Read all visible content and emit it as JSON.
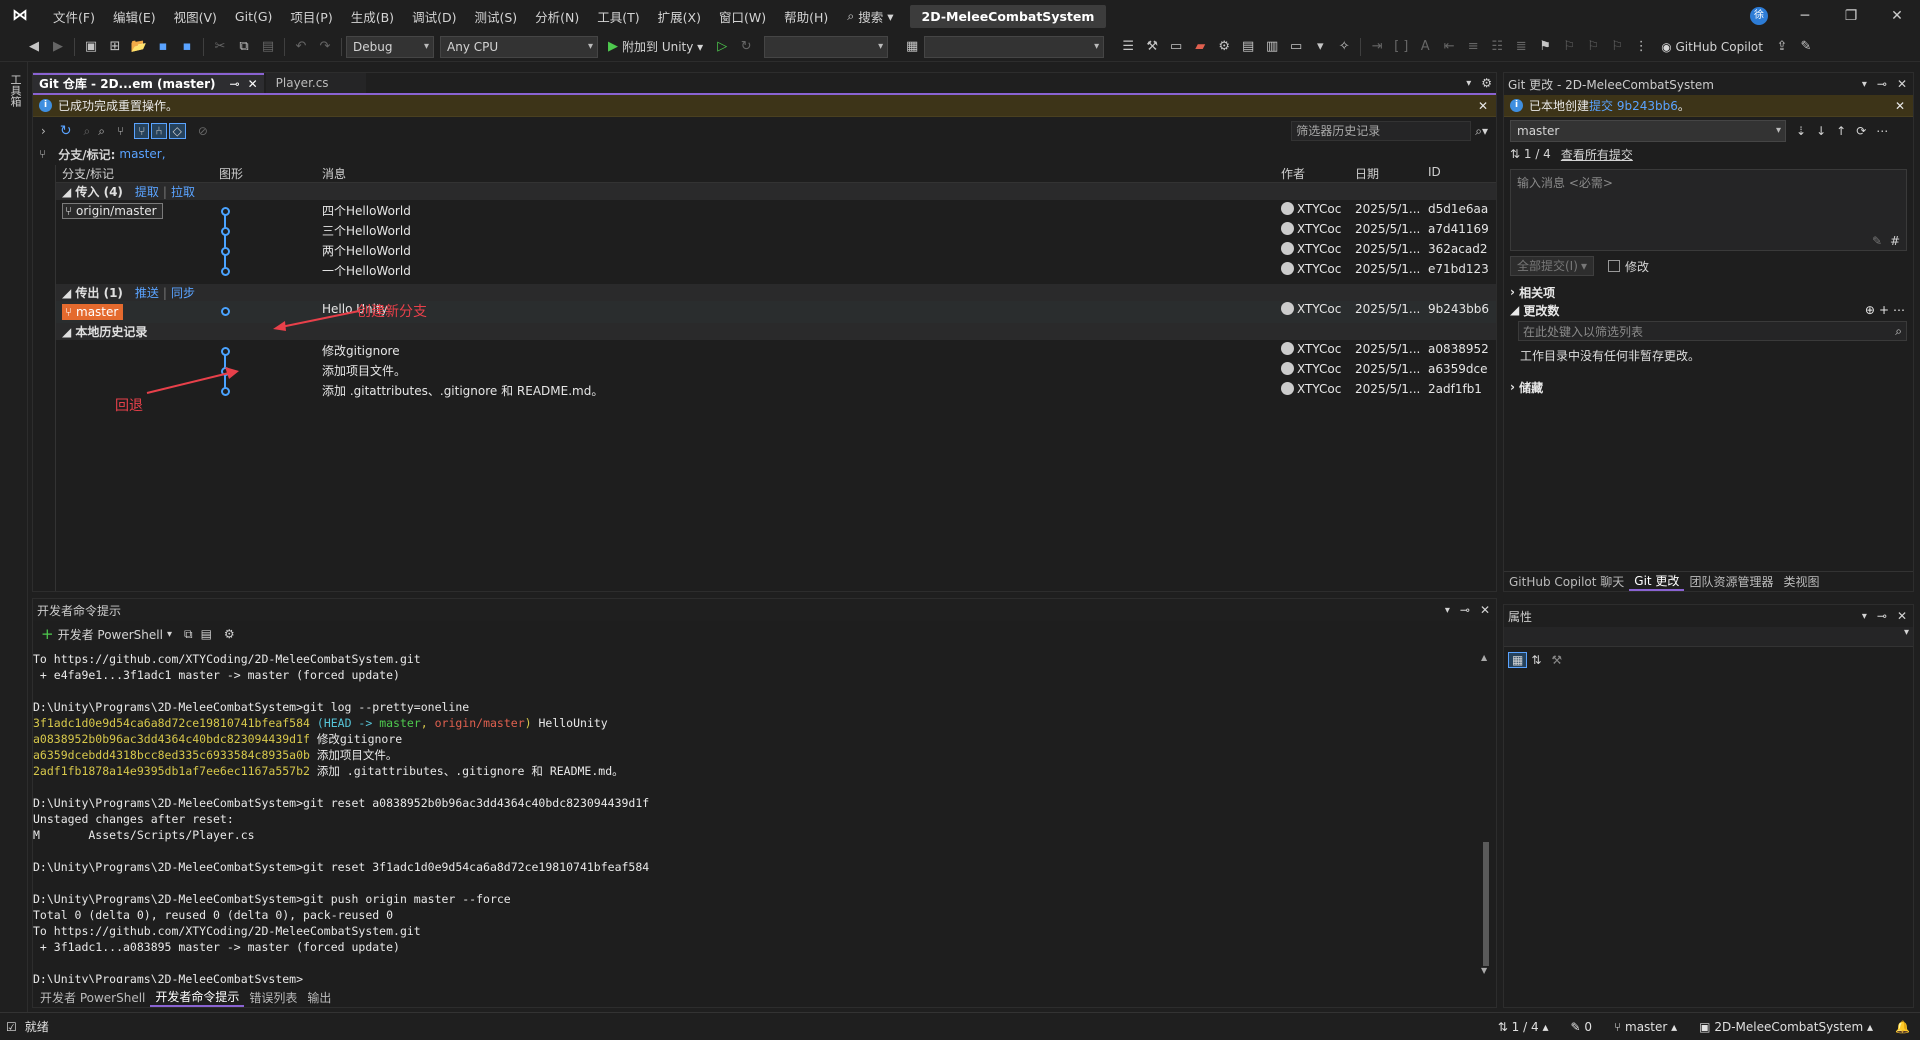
{
  "menu": [
    "文件(F)",
    "编辑(E)",
    "视图(V)",
    "Git(G)",
    "项目(P)",
    "生成(B)",
    "调试(D)",
    "测试(S)",
    "分析(N)",
    "工具(T)",
    "扩展(X)",
    "窗口(W)",
    "帮助(H)"
  ],
  "search_label": "搜索",
  "solution_name": "2D-MeleeCombatSystem",
  "avatar_letter": "徐",
  "toolbar": {
    "config": "Debug",
    "platform": "Any CPU",
    "attach": "附加到 Unity",
    "copilot": "GitHub Copilot"
  },
  "left_strip_label": "工具箱",
  "git_repo": {
    "tab_active": "Git 仓库 - 2D...em (master)",
    "tab_other": "Player.cs",
    "info": "已成功完成重置操作。",
    "filter_placeholder": "筛选器历史记录",
    "branch_label": "分支/标记:",
    "branch_value": "master,",
    "columns": {
      "branch": "分支/标记",
      "graph": "图形",
      "message": "消息",
      "author": "作者",
      "date": "日期",
      "id": "ID"
    },
    "incoming": {
      "title": "传入 (4)",
      "fetch": "提取",
      "pull": "拉取"
    },
    "outgoing": {
      "title": "传出 (1)",
      "push": "推送",
      "sync": "同步"
    },
    "local_history": "本地历史记录",
    "origin_tag": "origin/master",
    "master_tag": "master",
    "incoming_commits": [
      {
        "msg": "四个HelloWorld",
        "author": "XTYCoc",
        "date": "2025/5/1...",
        "id": "d5d1e6aa"
      },
      {
        "msg": "三个HelloWorld",
        "author": "XTYCoc",
        "date": "2025/5/1...",
        "id": "a7d41169"
      },
      {
        "msg": "两个HelloWorld",
        "author": "XTYCoc",
        "date": "2025/5/1...",
        "id": "362acad2"
      },
      {
        "msg": "一个HelloWorld",
        "author": "XTYCoc",
        "date": "2025/5/1...",
        "id": "e71bd123"
      }
    ],
    "outgoing_commits": [
      {
        "msg": "Hello Unity",
        "author": "XTYCoc",
        "date": "2025/5/1...",
        "id": "9b243bb6"
      }
    ],
    "local_commits": [
      {
        "msg": "修改gitignore",
        "author": "XTYCoc",
        "date": "2025/5/1...",
        "id": "a0838952"
      },
      {
        "msg": "添加项目文件。",
        "author": "XTYCoc",
        "date": "2025/5/1...",
        "id": "a6359dce"
      },
      {
        "msg": "添加 .gitattributes、.gitignore 和 README.md。",
        "author": "XTYCoc",
        "date": "2025/5/1...",
        "id": "2adf1fb1"
      }
    ],
    "annotation_new_branch": "创建新分支",
    "annotation_rollback": "回退"
  },
  "dev_prompt": {
    "title": "开发者命令提示",
    "new_shell": "开发者 PowerShell",
    "lines": [
      "To https://github.com/XTYCoding/2D-MeleeCombatSystem.git",
      " + e4fa9e1...3f1adc1 master -> master (forced update)",
      "",
      "D:\\Unity\\Programs\\2D-MeleeCombatSystem>git log --pretty=oneline"
    ],
    "log": [
      {
        "hash": "3f1adc1d0e9d54ca6a8d72ce19810741bfeaf584",
        "head": "(HEAD -> ",
        "master": "master",
        "sep": ", ",
        "origin": "origin/master",
        "close": ")",
        "msg": " HelloUnity"
      },
      {
        "hash": "a0838952b0b96ac3dd4364c40bdc823094439d1f",
        "msg": " 修改gitignore"
      },
      {
        "hash": "a6359dcebdd4318bcc8ed335c6933584c8935a0b",
        "msg": " 添加项目文件。"
      },
      {
        "hash": "2adf1fb1878a14e9395db1af7ee6ec1167a557b2",
        "msg": " 添加 .gitattributes、.gitignore 和 README.md。"
      }
    ],
    "lines2": [
      "",
      "D:\\Unity\\Programs\\2D-MeleeCombatSystem>git reset a0838952b0b96ac3dd4364c40bdc823094439d1f",
      "Unstaged changes after reset:",
      "M       Assets/Scripts/Player.cs",
      "",
      "D:\\Unity\\Programs\\2D-MeleeCombatSystem>git reset 3f1adc1d0e9d54ca6a8d72ce19810741bfeaf584",
      "",
      "D:\\Unity\\Programs\\2D-MeleeCombatSystem>git push origin master --force",
      "Total 0 (delta 0), reused 0 (delta 0), pack-reused 0",
      "To https://github.com/XTYCoding/2D-MeleeCombatSystem.git",
      " + 3f1adc1...a083895 master -> master (forced update)",
      "",
      "D:\\Unity\\Programs\\2D-MeleeCombatSystem>"
    ],
    "tabs": [
      "开发者 PowerShell",
      "开发者命令提示",
      "错误列表",
      "输出"
    ]
  },
  "git_changes": {
    "title": "Git 更改 - 2D-MeleeCombatSystem",
    "info_prefix": "已本地创建 ",
    "info_link": "提交 9b243bb6",
    "info_suffix": "。",
    "branch": "master",
    "outgoing": "1 / 4",
    "view_all": "查看所有提交",
    "msg_placeholder": "输入消息 <必需>",
    "commit_all": "全部提交(I)",
    "amend": "修改",
    "related": "相关项",
    "changes": "更改数",
    "filter_placeholder": "在此处键入以筛选列表",
    "no_changes": "工作目录中没有任何非暂存更改。",
    "stash": "储藏",
    "bottom_tabs": [
      "GitHub Copilot 聊天",
      "Git 更改",
      "团队资源管理器",
      "类视图"
    ]
  },
  "properties": {
    "title": "属性"
  },
  "status": {
    "ready": "就绪",
    "commits": "1 / 4",
    "pencil": "0",
    "branch": "master",
    "solution": "2D-MeleeCombatSystem"
  }
}
